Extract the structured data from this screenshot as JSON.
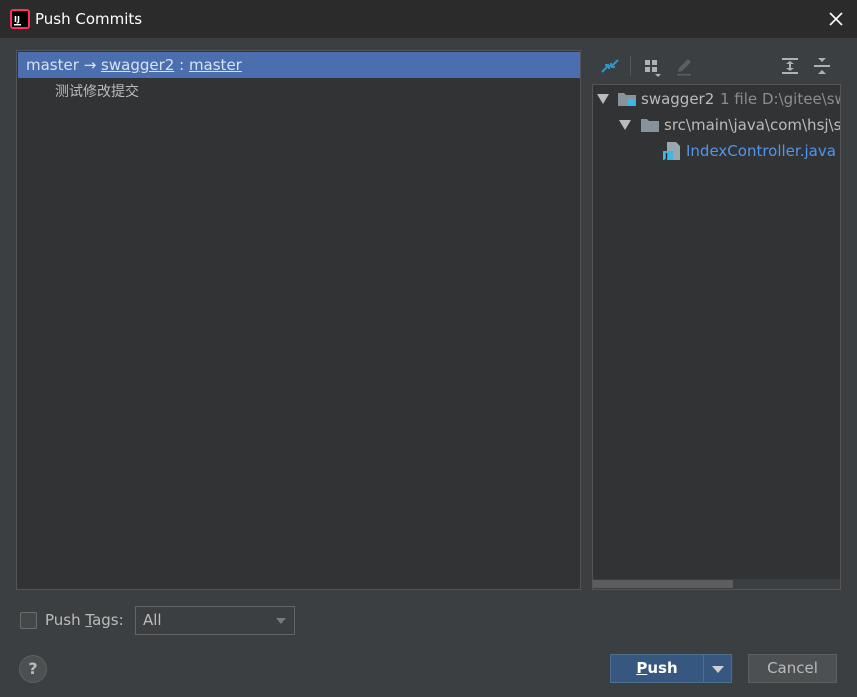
{
  "window": {
    "title": "Push Commits",
    "app_icon": "intellij-idea-icon",
    "close_icon": "close-icon"
  },
  "commits_panel": {
    "branch_row": {
      "local": "master",
      "arrow": "→",
      "remote": "swagger2",
      "sep": ":",
      "remote_branch": "master"
    },
    "commits": [
      {
        "message": "测试修改提交"
      }
    ]
  },
  "changes_toolbar": {
    "icons": [
      "collapse-arrows-icon",
      "group-by-icon",
      "edit-source-icon",
      "expand-all-icon",
      "collapse-all-icon"
    ]
  },
  "changes_tree": {
    "repo": {
      "name": "swagger2",
      "count": "1 file",
      "path": "D:\\gitee\\sw"
    },
    "folder": {
      "name": "src\\main\\java\\com\\hsj\\sw"
    },
    "file": {
      "name": "IndexController.java"
    }
  },
  "push_tags": {
    "label_pre": "Push ",
    "label_mnemonic": "T",
    "label_post": "ags:",
    "checked": false,
    "select_value": "All"
  },
  "buttons": {
    "push_mnemonic": "P",
    "push_rest": "ush",
    "cancel": "Cancel",
    "help": "?"
  },
  "colors": {
    "selection": "#4b6eaf",
    "link_file": "#5394ec",
    "primary_button": "#365880",
    "background": "#3c3f41"
  }
}
